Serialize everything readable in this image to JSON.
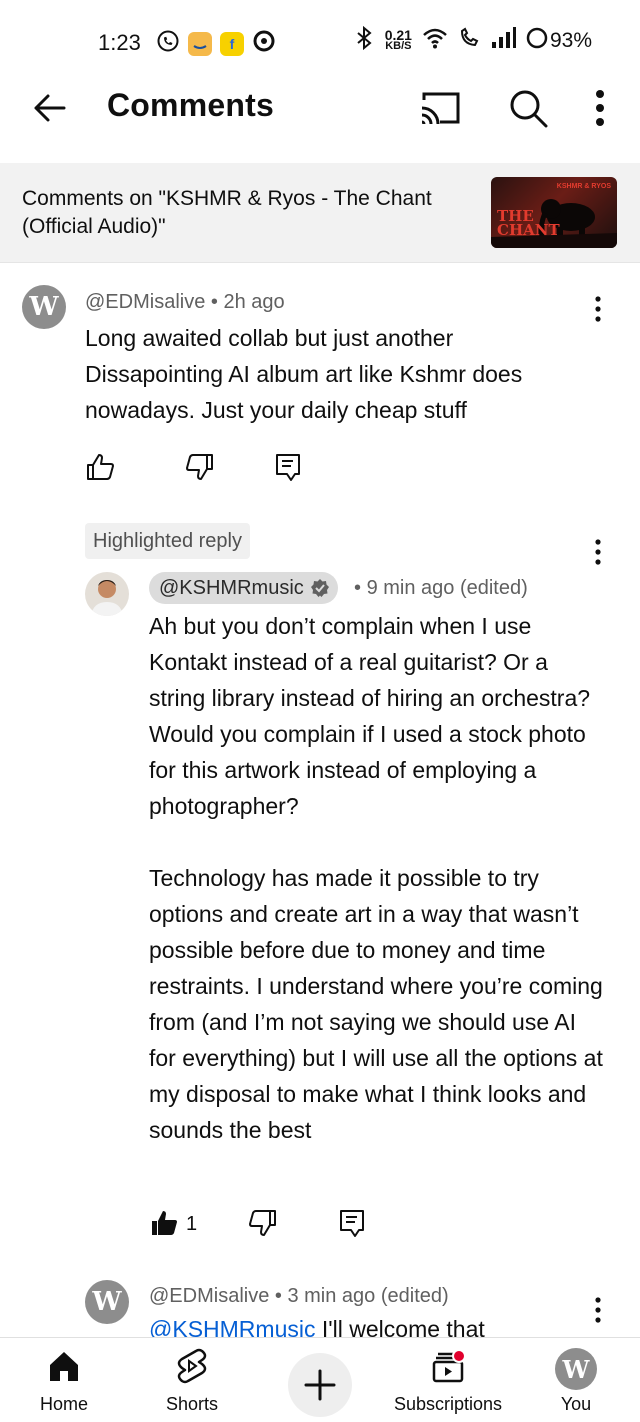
{
  "status_bar": {
    "time": "1:23",
    "speed_value": "0.21",
    "speed_unit": "KB/S",
    "battery": "93%"
  },
  "app_bar": {
    "title": "Comments"
  },
  "context": {
    "label": "Comments on \"KSHMR & Ryos - The Chant (Official Audio)\"",
    "thumb_title": "THE CHANT",
    "thumb_brand": "KSHMR & RYOS"
  },
  "comments": [
    {
      "author": "@EDMisalive",
      "time": "2h ago",
      "text": "Long awaited collab but just another Dissapointing AI album art like Kshmr does nowadays. Just your daily cheap stuff"
    }
  ],
  "highlighted_reply": {
    "chip_label": "Highlighted reply",
    "author": "@KSHMRmusic",
    "time": "9 min ago (edited)",
    "paragraph1": "Ah but you don’t complain when I use Kontakt instead of a real guitarist? Or a string library instead of hiring an orchestra? Would you complain if I used a stock photo for this artwork instead of employing a photographer?",
    "paragraph2": "Technology has made it possible to try options and create art in a way that wasn’t possible before due to money and time restraints. I understand where you’re coming from (and I’m not saying we should use AI for everything) but I will use all the options at my disposal to make what I think looks and sounds the best",
    "like_count": "1"
  },
  "next_reply": {
    "author": "@EDMisalive",
    "time": "3 min ago (edited)",
    "mention": "@KSHMRmusic",
    "text_start": "I'll welcome that"
  },
  "bottom_nav": {
    "home": "Home",
    "shorts": "Shorts",
    "subscriptions": "Subscriptions",
    "you": "You"
  },
  "colors": {
    "link": "#065fd4",
    "notification_dot": "#e1002d",
    "chip_bg": "#dcdcdc"
  }
}
